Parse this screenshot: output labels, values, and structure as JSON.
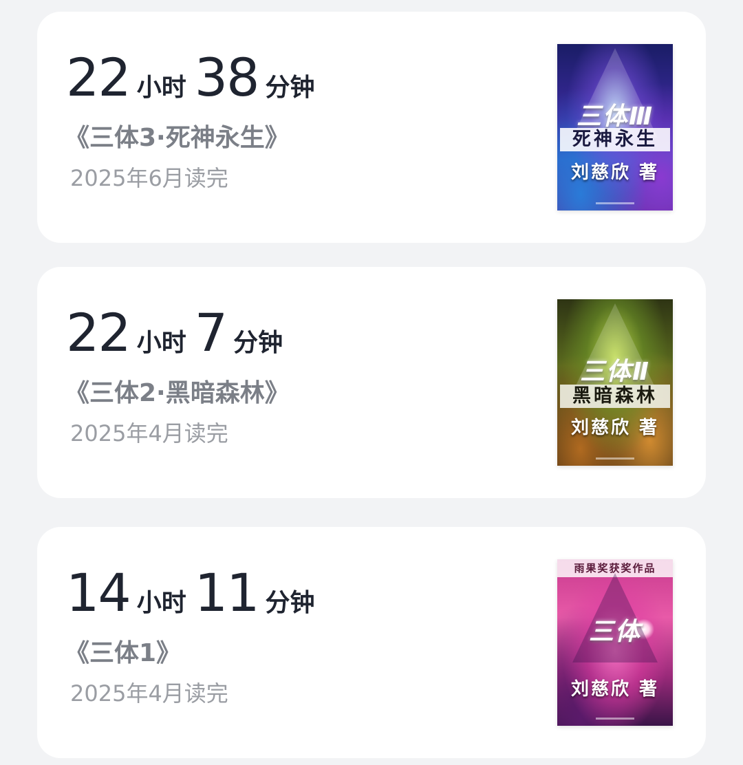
{
  "books": [
    {
      "hours": "22",
      "hours_unit": "小时",
      "minutes": "38",
      "minutes_unit": "分钟",
      "title": "《三体3·死神永生》",
      "finished": "2025年6月读完",
      "cover": {
        "series": "三体Ⅲ",
        "subtitle": "死神永生",
        "author": "刘慈欣 著",
        "colors": [
          "#1a1d66",
          "#3b2a9e",
          "#2c5fc4"
        ]
      }
    },
    {
      "hours": "22",
      "hours_unit": "小时",
      "minutes": "7",
      "minutes_unit": "分钟",
      "title": "《三体2·黑暗森林》",
      "finished": "2025年4月读完",
      "cover": {
        "series": "三体Ⅱ",
        "subtitle": "黑暗森林",
        "author": "刘慈欣 著",
        "colors": [
          "#2e3414",
          "#5a6a1e",
          "#b06a20"
        ]
      }
    },
    {
      "hours": "14",
      "hours_unit": "小时",
      "minutes": "11",
      "minutes_unit": "分钟",
      "title": "《三体1》",
      "finished": "2025年4月读完",
      "cover": {
        "banner": "雨果奖获奖作品",
        "series": "三体",
        "author": "刘慈欣 著",
        "colors": [
          "#c83a8e",
          "#e85aa8",
          "#3a1448"
        ]
      }
    }
  ]
}
